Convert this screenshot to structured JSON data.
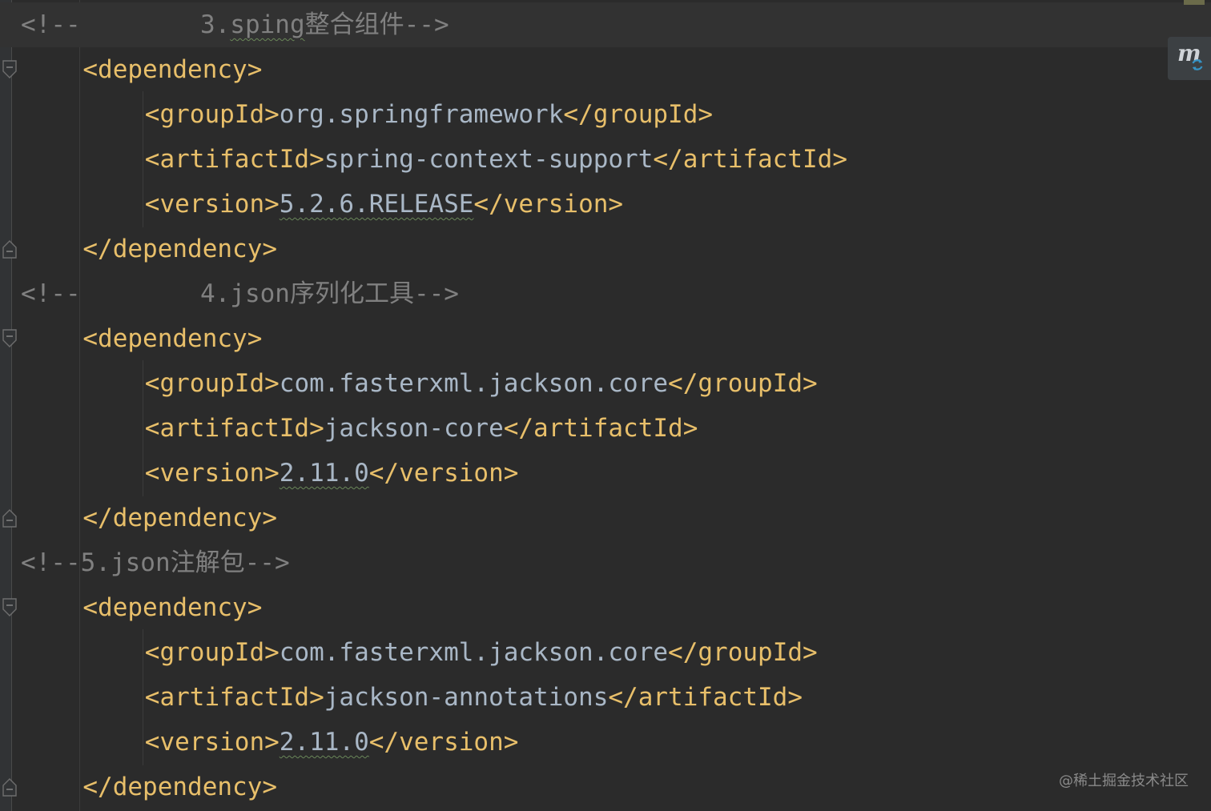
{
  "lines": [
    {
      "indent": "",
      "parts": [
        [
          "comment",
          "<!--"
        ],
        [
          "comment",
          "        3."
        ],
        [
          "comment squiggle",
          "sping"
        ],
        [
          "comment",
          "整合组件-->"
        ]
      ]
    },
    {
      "indent": "    ",
      "parts": [
        [
          "tag",
          "<dependency>"
        ]
      ]
    },
    {
      "indent": "        ",
      "parts": [
        [
          "tag",
          "<groupId>"
        ],
        [
          "text",
          "org.springframework"
        ],
        [
          "tag",
          "</groupId>"
        ]
      ]
    },
    {
      "indent": "        ",
      "parts": [
        [
          "tag",
          "<artifactId>"
        ],
        [
          "text",
          "spring-context-support"
        ],
        [
          "tag",
          "</artifactId>"
        ]
      ]
    },
    {
      "indent": "        ",
      "parts": [
        [
          "tag",
          "<version>"
        ],
        [
          "text squiggle",
          "5.2.6.RELEASE"
        ],
        [
          "tag",
          "</version>"
        ]
      ]
    },
    {
      "indent": "    ",
      "parts": [
        [
          "tag",
          "</dependency>"
        ]
      ]
    },
    {
      "indent": "",
      "parts": [
        [
          "comment",
          "<!--"
        ],
        [
          "comment",
          "        4.json序列化工具-->"
        ]
      ]
    },
    {
      "indent": "    ",
      "parts": [
        [
          "tag",
          "<dependency>"
        ]
      ]
    },
    {
      "indent": "        ",
      "parts": [
        [
          "tag",
          "<groupId>"
        ],
        [
          "text",
          "com.fasterxml.jackson.core"
        ],
        [
          "tag",
          "</groupId>"
        ]
      ]
    },
    {
      "indent": "        ",
      "parts": [
        [
          "tag",
          "<artifactId>"
        ],
        [
          "text",
          "jackson-core"
        ],
        [
          "tag",
          "</artifactId>"
        ]
      ]
    },
    {
      "indent": "        ",
      "parts": [
        [
          "tag",
          "<version>"
        ],
        [
          "text squiggle",
          "2.11.0"
        ],
        [
          "tag",
          "</version>"
        ]
      ]
    },
    {
      "indent": "    ",
      "parts": [
        [
          "tag",
          "</dependency>"
        ]
      ]
    },
    {
      "indent": "",
      "parts": [
        [
          "comment",
          "<!--5.json注解包-->"
        ]
      ]
    },
    {
      "indent": "    ",
      "parts": [
        [
          "tag",
          "<dependency>"
        ]
      ]
    },
    {
      "indent": "        ",
      "parts": [
        [
          "tag",
          "<groupId>"
        ],
        [
          "text",
          "com.fasterxml.jackson.core"
        ],
        [
          "tag",
          "</groupId>"
        ]
      ]
    },
    {
      "indent": "        ",
      "parts": [
        [
          "tag",
          "<artifactId>"
        ],
        [
          "text",
          "jackson-annotations"
        ],
        [
          "tag",
          "</artifactId>"
        ]
      ]
    },
    {
      "indent": "        ",
      "parts": [
        [
          "tag",
          "<version>"
        ],
        [
          "text squiggle",
          "2.11.0"
        ],
        [
          "tag",
          "</version>"
        ]
      ]
    },
    {
      "indent": "    ",
      "parts": [
        [
          "tag",
          "</dependency>"
        ]
      ]
    }
  ],
  "fold_marker_lines": [
    1,
    5,
    7,
    11,
    13,
    17
  ],
  "badge": {
    "letter": "m",
    "icon": "maven-refresh-icon"
  },
  "watermark": "@稀土掘金技术社区",
  "colors": {
    "background": "#2b2b2b",
    "tag": "#e8bf6a",
    "text": "#a9b7c6",
    "comment": "#808080"
  }
}
